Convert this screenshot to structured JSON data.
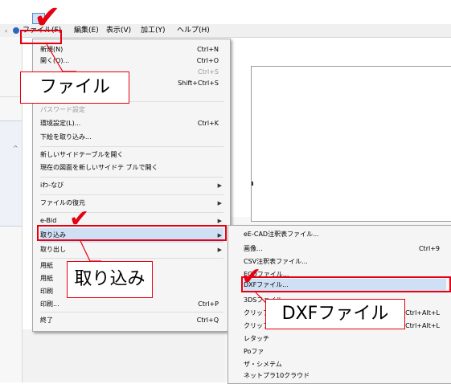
{
  "menubar": {
    "items": [
      "ファイル(F)",
      "編集(E)",
      "表示(V)",
      "加工(Y)",
      "ヘルプ(H)"
    ]
  },
  "file_menu": {
    "items": [
      {
        "label": "新規(N)",
        "shortcut": "Ctrl+N"
      },
      {
        "label": "開く(O)...",
        "shortcut": "Ctrl+O"
      },
      {
        "label": "",
        "shortcut": "Ctrl+S"
      },
      {
        "label": "",
        "shortcut": "Shift+Ctrl+S"
      },
      {
        "label": "パスワード設定",
        "shortcut": ""
      },
      {
        "label": "環境設定(L)...",
        "shortcut": "Ctrl+K"
      },
      {
        "label": "下絵を取り込み...",
        "shortcut": ""
      },
      {
        "label": "新しいサイドテーブルを開く",
        "shortcut": ""
      },
      {
        "label": "現在の図面を新しいサイドテ ブルで開く",
        "shortcut": ""
      },
      {
        "label": "iわ-なび",
        "shortcut": ""
      },
      {
        "label": "ファイルの復元",
        "shortcut": ""
      },
      {
        "label": "e-Bid",
        "shortcut": ""
      },
      {
        "label": "取り込み",
        "shortcut": ""
      },
      {
        "label": "取り出し",
        "shortcut": ""
      },
      {
        "label": "用紙",
        "shortcut": ""
      },
      {
        "label": "用紙",
        "shortcut": ""
      },
      {
        "label": "印刷",
        "shortcut": ""
      },
      {
        "label": "印刷...",
        "shortcut": "Ctrl+P"
      },
      {
        "label": "終了",
        "shortcut": "Ctrl+Q"
      }
    ]
  },
  "import_submenu": {
    "items": [
      {
        "label": "eE-CAD注釈表ファイル...",
        "shortcut": ""
      },
      {
        "label": "画像...",
        "shortcut": "Ctrl+9"
      },
      {
        "label": "CSV注釈表ファイル...",
        "shortcut": ""
      },
      {
        "label": "ECDファイル...",
        "shortcut": ""
      },
      {
        "label": "DXFファイル...",
        "shortcut": ""
      },
      {
        "label": "3DSファイル...",
        "shortcut": ""
      },
      {
        "label": "クリップファイルの読込（非表示）",
        "shortcut": "Ctrl+Alt+L"
      },
      {
        "label": "クリップ",
        "shortcut": "Ctrl+Alt+L"
      },
      {
        "label": "レタッチ",
        "shortcut": ""
      },
      {
        "label": "Poファ",
        "shortcut": ""
      },
      {
        "label": "ザ・シメテム",
        "shortcut": ""
      },
      {
        "label": "ネットプラ10クラウド",
        "shortcut": ""
      }
    ]
  },
  "annotations": {
    "file_label": "ファイル",
    "import_label": "取り込み",
    "dxf_label": "DXFファイル",
    "checkmark": "✔"
  },
  "colors": {
    "annotation_red": "#e60012",
    "highlight_blue": "#cfe0f5"
  }
}
